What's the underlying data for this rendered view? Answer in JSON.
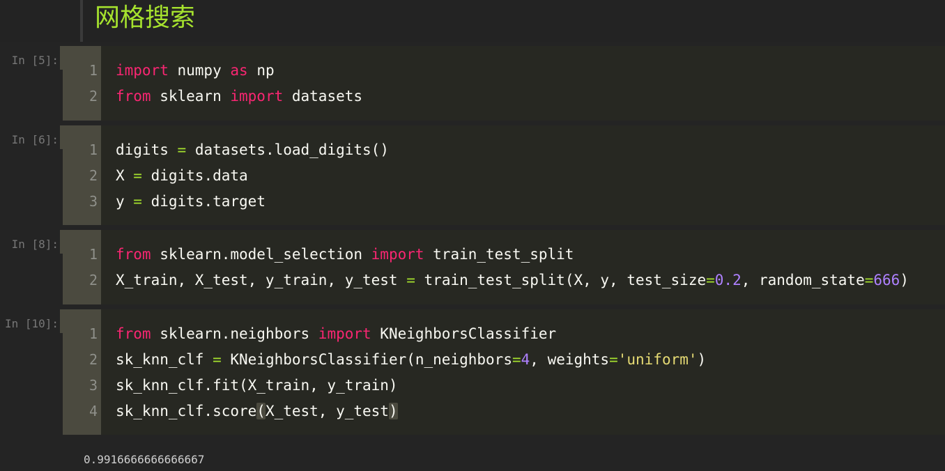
{
  "header": {
    "title": "网格搜索"
  },
  "cells": [
    {
      "prompt": "In [5]:",
      "lines": [
        {
          "n": "1",
          "tokens": [
            [
              "kw",
              "import"
            ],
            [
              "txt",
              " numpy "
            ],
            [
              "kw",
              "as"
            ],
            [
              "txt",
              " np"
            ]
          ]
        },
        {
          "n": "2",
          "tokens": [
            [
              "kw",
              "from"
            ],
            [
              "txt",
              " sklearn "
            ],
            [
              "kw",
              "import"
            ],
            [
              "txt",
              " datasets"
            ]
          ]
        }
      ]
    },
    {
      "prompt": "In [6]:",
      "lines": [
        {
          "n": "1",
          "tokens": [
            [
              "txt",
              "digits "
            ],
            [
              "op",
              "="
            ],
            [
              "txt",
              " datasets.load_digits()"
            ]
          ]
        },
        {
          "n": "2",
          "tokens": [
            [
              "txt",
              "X "
            ],
            [
              "op",
              "="
            ],
            [
              "txt",
              " digits.data"
            ]
          ]
        },
        {
          "n": "3",
          "tokens": [
            [
              "txt",
              "y "
            ],
            [
              "op",
              "="
            ],
            [
              "txt",
              " digits.target"
            ]
          ]
        }
      ]
    },
    {
      "prompt": "In [8]:",
      "lines": [
        {
          "n": "1",
          "tokens": [
            [
              "kw",
              "from"
            ],
            [
              "txt",
              " sklearn.model_selection "
            ],
            [
              "kw",
              "import"
            ],
            [
              "txt",
              " train_test_split"
            ]
          ]
        },
        {
          "n": "2",
          "tokens": [
            [
              "txt",
              "X_train, X_test, y_train, y_test "
            ],
            [
              "op",
              "="
            ],
            [
              "txt",
              " train_test_split(X, y, test_size"
            ],
            [
              "op",
              "="
            ],
            [
              "num",
              "0.2"
            ],
            [
              "txt",
              ", random_state"
            ],
            [
              "op",
              "="
            ],
            [
              "num",
              "666"
            ],
            [
              "txt",
              ")"
            ]
          ]
        }
      ]
    },
    {
      "prompt": "In [10]:",
      "lines": [
        {
          "n": "1",
          "tokens": [
            [
              "kw",
              "from"
            ],
            [
              "txt",
              " sklearn.neighbors "
            ],
            [
              "kw",
              "import"
            ],
            [
              "txt",
              " KNeighborsClassifier"
            ]
          ]
        },
        {
          "n": "2",
          "tokens": [
            [
              "txt",
              "sk_knn_clf "
            ],
            [
              "op",
              "="
            ],
            [
              "txt",
              " KNeighborsClassifier(n_neighbors"
            ],
            [
              "op",
              "="
            ],
            [
              "num",
              "4"
            ],
            [
              "txt",
              ", weights"
            ],
            [
              "op",
              "="
            ],
            [
              "str",
              "'uniform'"
            ],
            [
              "txt",
              ")"
            ]
          ]
        },
        {
          "n": "3",
          "tokens": [
            [
              "txt",
              "sk_knn_clf.fit(X_train, y_train)"
            ]
          ]
        },
        {
          "n": "4",
          "tokens": [
            [
              "txt",
              "sk_knn_clf.score"
            ],
            [
              "match",
              "("
            ],
            [
              "txt",
              "X_test, y_test"
            ],
            [
              "match",
              ")"
            ]
          ]
        }
      ]
    }
  ],
  "output": {
    "text": "0.9916666666666667"
  },
  "colors": {
    "keyword": "#f92672",
    "operator": "#a6e22e",
    "number": "#ae81ff",
    "string": "#e6db74",
    "title": "#a6e22e"
  }
}
